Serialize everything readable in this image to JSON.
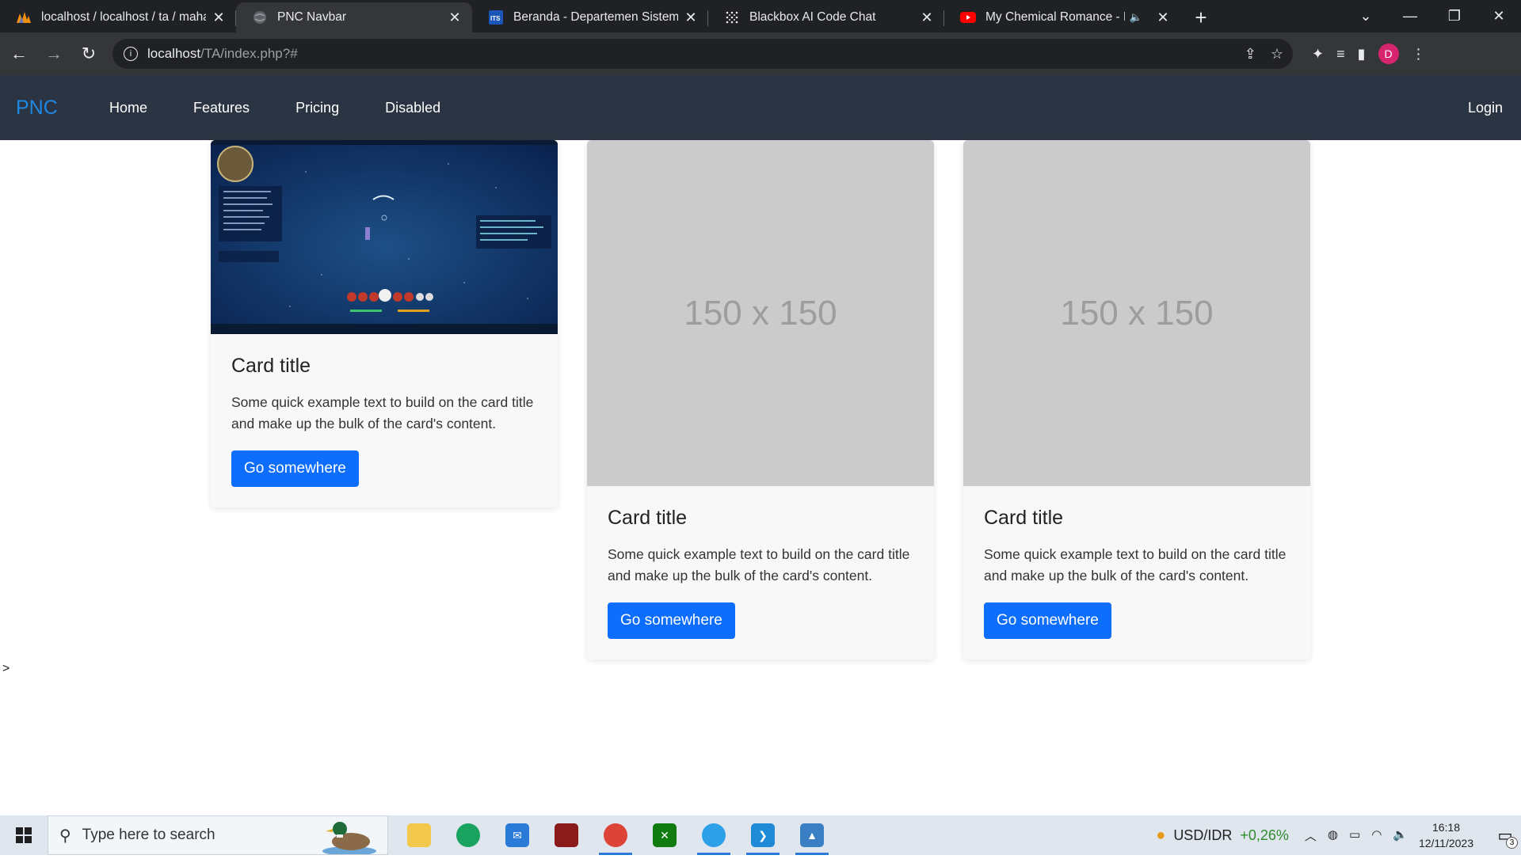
{
  "browser": {
    "tabs": [
      {
        "title": "localhost / localhost / ta / mahas",
        "icon": "phpmyadmin-icon",
        "active": false
      },
      {
        "title": "PNC Navbar",
        "icon": "globe-icon",
        "active": true
      },
      {
        "title": "Beranda - Departemen Sistem In",
        "icon": "its-icon",
        "active": false
      },
      {
        "title": "Blackbox AI Code Chat",
        "icon": "blackbox-icon",
        "active": false
      },
      {
        "title": "My Chemical Romance - Dis",
        "icon": "youtube-icon",
        "active": false,
        "audio": true
      }
    ],
    "address": {
      "host": "localhost",
      "path": "/TA/index.php?#"
    },
    "profile_initial": "D"
  },
  "navbar": {
    "brand": "PNC",
    "links": [
      "Home",
      "Features",
      "Pricing",
      "Disabled"
    ],
    "login": "Login"
  },
  "cards": [
    {
      "image": "game screenshot",
      "title": "Card title",
      "text": "Some quick example text to build on the card title and make up the bulk of the card's content.",
      "button": "Go somewhere"
    },
    {
      "image_label": "150 x 150",
      "title": "Card title",
      "text": "Some quick example text to build on the card title and make up the bulk of the card's content.",
      "button": "Go somewhere"
    },
    {
      "image_label": "150 x 150",
      "title": "Card title",
      "text": "Some quick example text to build on the card title and make up the bulk of the card's content.",
      "button": "Go somewhere"
    }
  ],
  "stray_text": ">",
  "taskbar": {
    "search_placeholder": "Type here to search",
    "ticker_label": "USD/IDR",
    "ticker_change": "+0,26%",
    "time": "16:18",
    "date": "12/11/2023",
    "notification_count": "3"
  },
  "colors": {
    "navbar_bg": "#2b3442",
    "brand": "#1e88e5",
    "button": "#0d6efd",
    "placeholder_bg": "#cbcbcb"
  }
}
